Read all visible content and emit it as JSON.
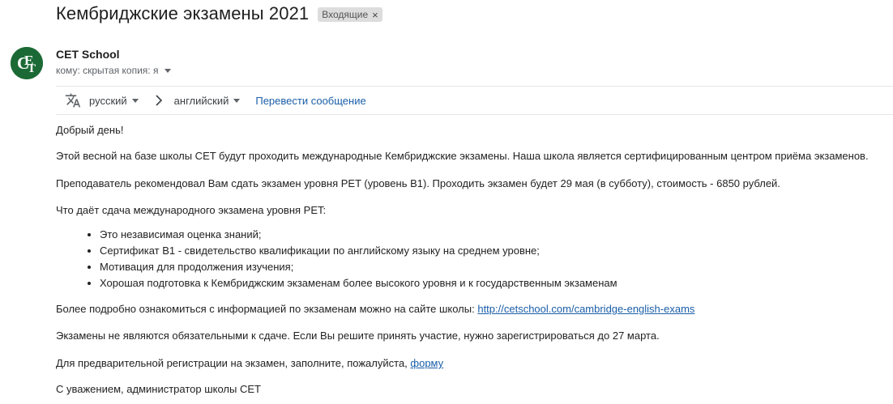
{
  "email": {
    "subject": "Кембриджские экзамены 2021",
    "label": "Входящие",
    "label_close": "×",
    "sender": {
      "name": "CET School",
      "avatar_text": "CET",
      "avatar_color": "#1b6a35"
    },
    "recipients": "кому: скрытая копия: я"
  },
  "translate_bar": {
    "icon": "translate-icon",
    "source_lang": "русский",
    "target_lang": "английский",
    "translate_link": "Перевести сообщение"
  },
  "body": {
    "greeting": "Добрый день!",
    "p1": "Этой весной на базе школы CET будут проходить международные Кембриджские экзамены. Наша школа является сертифицированным центром приёма экзаменов.",
    "p2": "Преподаватель рекомендовал Вам сдать экзамен уровня  PET (уровень B1). Проходить экзамен будет 29 мая (в субботу), стоимость - 6850 рублей.",
    "p3": "Что даёт сдача международного экзамена уровня  PET:",
    "bullets": [
      "Это независимая оценка знаний;",
      "Сертификат B1 - свидетельство квалификации по английскому языку на среднем уровне;",
      "Мотивация для продолжения изучения;",
      "Хорошая подготовка к Кембриджским экзаменам более высокого уровня и к государственным экзаменам"
    ],
    "p4_prefix": "Более подробно ознакомиться с информацией по экзаменам можно на сайте школы: ",
    "p4_link": "http://cetschool.com/cambridge-english-exams",
    "p5": "Экзамены не являются обязательными к сдаче. Если Вы решите принять участие, нужно зарегистрироваться до 27 марта.",
    "p6_prefix": "Для предварительной регистрации на экзамен, заполните, пожалуйста, ",
    "p6_link": "форму ",
    "signature": "С уважением, администратор школы CET"
  }
}
